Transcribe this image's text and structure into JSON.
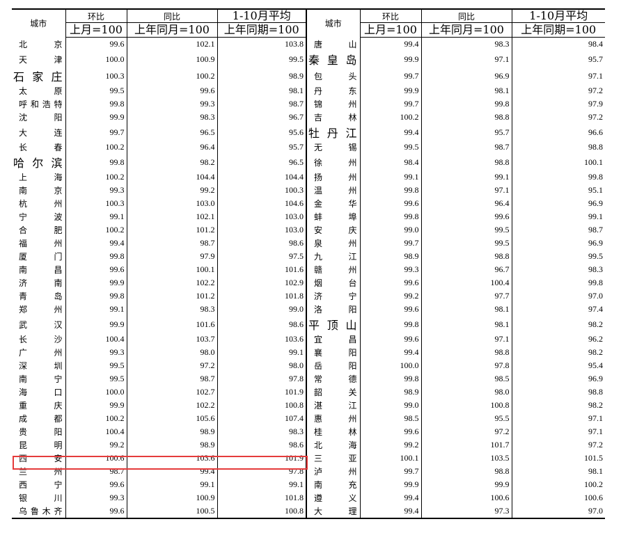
{
  "header": {
    "city_label": "城市",
    "mom_label": "环比",
    "mom_base": "上月=100",
    "yoy_label": "同比",
    "yoy_base": "上年同月=100",
    "avg_label": "1-10月平均",
    "avg_base": "上年同期=100"
  },
  "rows": [
    {
      "left": {
        "city": "北京",
        "mom": "99.6",
        "yoy": "102.1",
        "avg": "103.8"
      },
      "right": {
        "city": "唐山",
        "mom": "99.4",
        "yoy": "98.3",
        "avg": "98.4"
      }
    },
    {
      "left": {
        "city": "天津",
        "mom": "100.0",
        "yoy": "100.9",
        "avg": "99.5"
      },
      "right": {
        "city": "秦皇岛",
        "mom": "99.9",
        "yoy": "97.1",
        "avg": "95.7"
      }
    },
    {
      "left": {
        "city": "石家庄",
        "mom": "100.3",
        "yoy": "100.2",
        "avg": "98.9"
      },
      "right": {
        "city": "包头",
        "mom": "99.7",
        "yoy": "96.9",
        "avg": "97.1"
      }
    },
    {
      "left": {
        "city": "太原",
        "mom": "99.5",
        "yoy": "99.6",
        "avg": "98.1"
      },
      "right": {
        "city": "丹东",
        "mom": "99.9",
        "yoy": "98.1",
        "avg": "97.2"
      }
    },
    {
      "left": {
        "city": "呼和浩特",
        "mom": "99.8",
        "yoy": "99.3",
        "avg": "98.7"
      },
      "right": {
        "city": "锦州",
        "mom": "99.7",
        "yoy": "99.8",
        "avg": "97.9"
      }
    },
    {
      "left": {
        "city": "沈阳",
        "mom": "99.9",
        "yoy": "98.3",
        "avg": "96.7"
      },
      "right": {
        "city": "吉林",
        "mom": "100.2",
        "yoy": "98.8",
        "avg": "97.2"
      }
    },
    {
      "left": {
        "city": "大连",
        "mom": "99.7",
        "yoy": "96.5",
        "avg": "95.6"
      },
      "right": {
        "city": "牡丹江",
        "mom": "99.4",
        "yoy": "95.7",
        "avg": "96.6"
      }
    },
    {
      "left": {
        "city": "长春",
        "mom": "100.2",
        "yoy": "96.4",
        "avg": "95.7"
      },
      "right": {
        "city": "无锡",
        "mom": "99.5",
        "yoy": "98.7",
        "avg": "98.8"
      }
    },
    {
      "left": {
        "city": "哈尔滨",
        "mom": "99.8",
        "yoy": "98.2",
        "avg": "96.5"
      },
      "right": {
        "city": "徐州",
        "mom": "98.4",
        "yoy": "98.8",
        "avg": "100.1"
      }
    },
    {
      "left": {
        "city": "上海",
        "mom": "100.2",
        "yoy": "104.4",
        "avg": "104.4"
      },
      "right": {
        "city": "扬州",
        "mom": "99.1",
        "yoy": "99.1",
        "avg": "99.8"
      }
    },
    {
      "left": {
        "city": "南京",
        "mom": "99.3",
        "yoy": "99.2",
        "avg": "100.3"
      },
      "right": {
        "city": "温州",
        "mom": "99.8",
        "yoy": "97.1",
        "avg": "95.1"
      }
    },
    {
      "left": {
        "city": "杭州",
        "mom": "100.3",
        "yoy": "103.0",
        "avg": "104.6"
      },
      "right": {
        "city": "金华",
        "mom": "99.6",
        "yoy": "96.4",
        "avg": "96.9"
      }
    },
    {
      "left": {
        "city": "宁波",
        "mom": "99.1",
        "yoy": "102.1",
        "avg": "103.0"
      },
      "right": {
        "city": "蚌埠",
        "mom": "99.8",
        "yoy": "99.6",
        "avg": "99.1"
      }
    },
    {
      "left": {
        "city": "合肥",
        "mom": "100.2",
        "yoy": "101.2",
        "avg": "103.0"
      },
      "right": {
        "city": "安庆",
        "mom": "99.0",
        "yoy": "99.5",
        "avg": "98.7"
      }
    },
    {
      "left": {
        "city": "福州",
        "mom": "99.4",
        "yoy": "98.7",
        "avg": "98.6"
      },
      "right": {
        "city": "泉州",
        "mom": "99.7",
        "yoy": "99.5",
        "avg": "96.9"
      }
    },
    {
      "left": {
        "city": "厦门",
        "mom": "99.8",
        "yoy": "97.9",
        "avg": "97.5"
      },
      "right": {
        "city": "九江",
        "mom": "98.9",
        "yoy": "98.8",
        "avg": "99.5"
      }
    },
    {
      "left": {
        "city": "南昌",
        "mom": "99.6",
        "yoy": "100.1",
        "avg": "101.6"
      },
      "right": {
        "city": "赣州",
        "mom": "99.3",
        "yoy": "96.7",
        "avg": "98.3"
      }
    },
    {
      "left": {
        "city": "济南",
        "mom": "99.9",
        "yoy": "102.2",
        "avg": "102.9"
      },
      "right": {
        "city": "烟台",
        "mom": "99.6",
        "yoy": "100.4",
        "avg": "99.8"
      }
    },
    {
      "left": {
        "city": "青岛",
        "mom": "99.8",
        "yoy": "101.2",
        "avg": "101.8"
      },
      "right": {
        "city": "济宁",
        "mom": "99.2",
        "yoy": "97.7",
        "avg": "97.0"
      }
    },
    {
      "left": {
        "city": "郑州",
        "mom": "99.1",
        "yoy": "98.3",
        "avg": "99.0"
      },
      "right": {
        "city": "洛阳",
        "mom": "99.6",
        "yoy": "98.1",
        "avg": "97.4"
      }
    },
    {
      "left": {
        "city": "武汉",
        "mom": "99.9",
        "yoy": "101.6",
        "avg": "98.6"
      },
      "right": {
        "city": "平顶山",
        "mom": "99.8",
        "yoy": "98.1",
        "avg": "98.2"
      }
    },
    {
      "left": {
        "city": "长沙",
        "mom": "100.4",
        "yoy": "103.7",
        "avg": "103.6"
      },
      "right": {
        "city": "宜昌",
        "mom": "99.6",
        "yoy": "97.1",
        "avg": "96.2"
      }
    },
    {
      "left": {
        "city": "广州",
        "mom": "99.3",
        "yoy": "98.0",
        "avg": "99.1"
      },
      "right": {
        "city": "襄阳",
        "mom": "99.4",
        "yoy": "98.8",
        "avg": "98.2"
      }
    },
    {
      "left": {
        "city": "深圳",
        "mom": "99.5",
        "yoy": "97.2",
        "avg": "98.0"
      },
      "right": {
        "city": "岳阳",
        "mom": "100.0",
        "yoy": "97.8",
        "avg": "95.4"
      }
    },
    {
      "left": {
        "city": "南宁",
        "mom": "99.5",
        "yoy": "98.7",
        "avg": "97.8"
      },
      "right": {
        "city": "常德",
        "mom": "99.8",
        "yoy": "98.5",
        "avg": "96.9"
      }
    },
    {
      "left": {
        "city": "海口",
        "mom": "100.0",
        "yoy": "102.7",
        "avg": "101.9"
      },
      "right": {
        "city": "韶关",
        "mom": "98.9",
        "yoy": "98.0",
        "avg": "98.8"
      }
    },
    {
      "left": {
        "city": "重庆",
        "mom": "99.9",
        "yoy": "102.2",
        "avg": "100.8"
      },
      "right": {
        "city": "湛江",
        "mom": "99.0",
        "yoy": "100.8",
        "avg": "98.2"
      }
    },
    {
      "left": {
        "city": "成都",
        "mom": "100.2",
        "yoy": "105.6",
        "avg": "107.4"
      },
      "right": {
        "city": "惠州",
        "mom": "98.5",
        "yoy": "95.5",
        "avg": "97.1"
      }
    },
    {
      "left": {
        "city": "贵阳",
        "mom": "100.4",
        "yoy": "98.9",
        "avg": "98.3"
      },
      "right": {
        "city": "桂林",
        "mom": "99.6",
        "yoy": "97.2",
        "avg": "97.1"
      }
    },
    {
      "left": {
        "city": "昆明",
        "mom": "99.2",
        "yoy": "98.9",
        "avg": "98.6"
      },
      "right": {
        "city": "北海",
        "mom": "99.2",
        "yoy": "101.7",
        "avg": "97.2"
      }
    },
    {
      "left": {
        "city": "西安",
        "mom": "100.6",
        "yoy": "103.6",
        "avg": "101.9"
      },
      "right": {
        "city": "三亚",
        "mom": "100.1",
        "yoy": "103.5",
        "avg": "101.5"
      }
    },
    {
      "left": {
        "city": "兰州",
        "mom": "98.7",
        "yoy": "99.4",
        "avg": "97.8"
      },
      "right": {
        "city": "泸州",
        "mom": "99.7",
        "yoy": "98.8",
        "avg": "98.1"
      }
    },
    {
      "left": {
        "city": "西宁",
        "mom": "99.6",
        "yoy": "99.1",
        "avg": "99.1"
      },
      "right": {
        "city": "南充",
        "mom": "99.9",
        "yoy": "99.9",
        "avg": "100.2"
      }
    },
    {
      "left": {
        "city": "银川",
        "mom": "99.3",
        "yoy": "100.9",
        "avg": "101.8"
      },
      "right": {
        "city": "遵义",
        "mom": "99.4",
        "yoy": "100.6",
        "avg": "100.6"
      }
    },
    {
      "left": {
        "city": "乌鲁木齐",
        "mom": "99.6",
        "yoy": "100.5",
        "avg": "100.8"
      },
      "right": {
        "city": "大理",
        "mom": "99.4",
        "yoy": "97.3",
        "avg": "97.0"
      }
    }
  ],
  "big_city_names": [
    "石家庄",
    "哈尔滨",
    "秦皇岛",
    "牡丹江",
    "平顶山"
  ],
  "highlight": {
    "city": "西安",
    "color": "#e53b3b"
  }
}
